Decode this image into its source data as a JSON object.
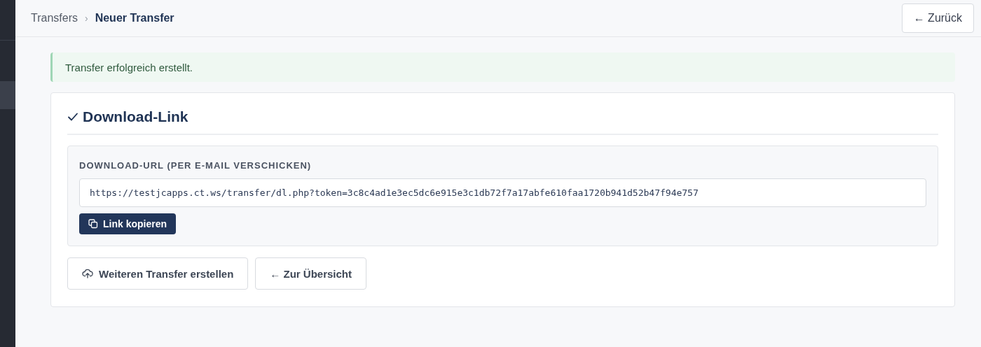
{
  "breadcrumb": {
    "separator": "›",
    "items": [
      {
        "label": "Transfers",
        "current": false
      },
      {
        "label": "Neuer Transfer",
        "current": true
      }
    ]
  },
  "back_button": "← Zurück",
  "alert": {
    "kind": "success",
    "message": "Transfer erfolgreich erstellt."
  },
  "card": {
    "title": "Download-Link",
    "url_label": "DOWNLOAD-URL (PER E-MAIL VERSCHICKEN)",
    "url_value": "https://testjcapps.ct.ws/transfer/dl.php?token=3c8c4ad1e3ec5dc6e915e3c1db72f7a17abfe610faa1720b941d52b47f94e757",
    "copy_button": "Link kopieren",
    "actions": [
      {
        "kind": "upload",
        "label": "Weiteren Transfer erstellen"
      },
      {
        "kind": "plain",
        "label": "← Zur Übersicht"
      }
    ]
  }
}
